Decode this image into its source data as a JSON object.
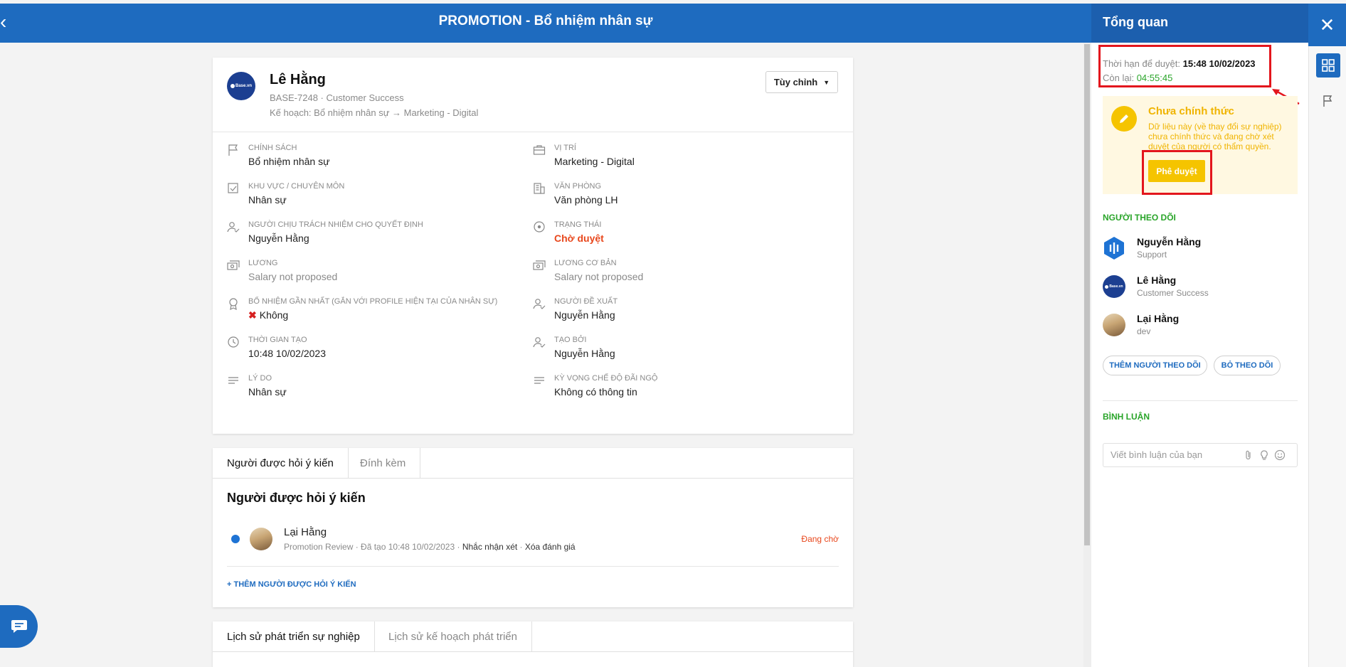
{
  "header": {
    "title": "PROMOTION - Bổ nhiệm nhân sự",
    "back_icon": "chevron-left-icon"
  },
  "employee": {
    "name": "Lê Hằng",
    "meta": "BASE-7248 · Customer Success",
    "plan": "Kế hoạch: Bổ nhiệm nhân sự → Marketing - Digital",
    "avatar_text": "Base.vn",
    "customize_label": "Tùy chỉnh"
  },
  "fields": {
    "chinh_sach": {
      "label": "Chính sách",
      "value": "Bổ nhiệm nhân sự",
      "icon": "flag-icon"
    },
    "vi_tri": {
      "label": "Vị trí",
      "value": "Marketing - Digital",
      "icon": "briefcase-icon"
    },
    "khu_vuc": {
      "label": "Khu vực / Chuyên môn",
      "value": "Nhân sự",
      "icon": "checkbox-icon"
    },
    "van_phong": {
      "label": "Văn phòng",
      "value": "Văn phòng LH",
      "icon": "building-icon"
    },
    "nguoi_chiu": {
      "label": "Người chịu trách nhiệm cho quyết định",
      "value": "Nguyễn Hằng",
      "icon": "user-check-icon"
    },
    "trang_thai": {
      "label": "Trạng thái",
      "value": "Chờ duyệt",
      "icon": "target-icon"
    },
    "luong": {
      "label": "Lương",
      "value": "Salary not proposed",
      "icon": "money-icon"
    },
    "luong_co_ban": {
      "label": "Lương cơ bản",
      "value": "Salary not proposed",
      "icon": "money-icon"
    },
    "bo_nhiem": {
      "label": "Bổ nhiệm gần nhất (gắn với profile hiện tại của nhân sự)",
      "value": "Không",
      "icon": "medal-icon"
    },
    "nguoi_de_xuat": {
      "label": "Người đề xuất",
      "value": "Nguyễn Hằng",
      "icon": "user-check-icon"
    },
    "thoi_gian": {
      "label": "Thời gian tạo",
      "value": "10:48 10/02/2023",
      "icon": "clock-icon"
    },
    "tao_boi": {
      "label": "Tạo bởi",
      "value": "Nguyễn Hằng",
      "icon": "user-check-icon"
    },
    "ly_do": {
      "label": "Lý do",
      "value": "Nhân sự",
      "icon": "lines-icon"
    },
    "ky_vong": {
      "label": "Kỳ vọng chế độ đãi ngộ",
      "value": "Không có thông tin",
      "icon": "lines-icon"
    }
  },
  "reviews": {
    "tabs": [
      "Người được hỏi ý kiến",
      "Đính kèm"
    ],
    "title": "Người được hỏi ý kiến",
    "reviewer": {
      "name": "Lại Hằng",
      "meta": "Promotion Review · Đã tạo 10:48 10/02/2023 · ",
      "remind": "Nhắc nhận xét",
      "sep": " · ",
      "delete": "Xóa đánh giá",
      "status": "Đang chờ"
    },
    "add_label": "+ THÊM NGƯỜI ĐƯỢC HỎI Ý KIẾN"
  },
  "history": {
    "tabs": [
      "Lịch sử phát triển sự nghiệp",
      "Lịch sử kế hoạch phát triển"
    ]
  },
  "sidebar": {
    "title": "Tổng quan",
    "deadline_label": "Thời hạn để duyệt: ",
    "deadline_value": "15:48 10/02/2023",
    "remaining_label": "Còn lại: ",
    "remaining_value": "04:55:45",
    "notice_title": "Chưa chính thức",
    "notice_desc": "Dữ liệu này (về thay đổi sự nghiệp) chưa chính thức và đang chờ xét duyệt của người có thẩm quyền.",
    "approve_label": "Phê duyệt",
    "followers_title": "Người theo dõi",
    "followers": [
      {
        "name": "Nguyễn Hằng",
        "role": "Support"
      },
      {
        "name": "Lê Hằng",
        "role": "Customer Success"
      },
      {
        "name": "Lại Hằng",
        "role": "dev"
      }
    ],
    "add_follower": "THÊM NGƯỜI THEO DÕI",
    "unfollow": "BỎ THEO DÕI",
    "comments_title": "Bình luận",
    "comment_placeholder": "Viết bình luận của bạn"
  },
  "colors": {
    "primary": "#1e6bbf",
    "accent_yellow": "#f5c400",
    "status_red": "#e8471c",
    "success_green": "#2aa52a",
    "highlight_box": "#e3161d"
  }
}
